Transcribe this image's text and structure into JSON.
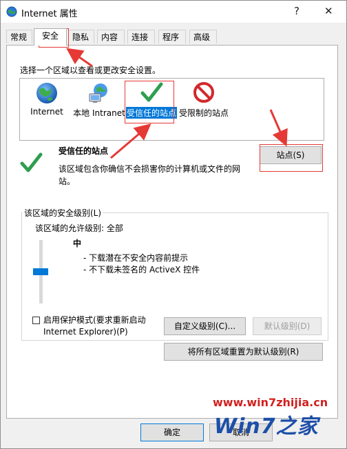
{
  "window": {
    "title": "Internet 属性",
    "help": "?",
    "close": "✕"
  },
  "tabs": [
    {
      "label": "常规"
    },
    {
      "label": "安全"
    },
    {
      "label": "隐私"
    },
    {
      "label": "内容"
    },
    {
      "label": "连接"
    },
    {
      "label": "程序"
    },
    {
      "label": "高级"
    }
  ],
  "security": {
    "instruction": "选择一个区域以查看或更改安全设置。",
    "zones": [
      {
        "label": "Internet",
        "icon": "globe-icon"
      },
      {
        "label": "本地 Intranet",
        "icon": "intranet-icon"
      },
      {
        "label": "受信任的站点",
        "icon": "checkmark-icon"
      },
      {
        "label": "受限制的站点",
        "icon": "restricted-icon"
      }
    ],
    "selected_zone": {
      "title": "受信任的站点",
      "description": "该区域包含你确信不会损害你的计算机或文件的网站。",
      "sites_button": "站点(S)"
    },
    "level_group": {
      "legend": "该区域的安全级别(L)",
      "allowed": "该区域的允许级别: 全部",
      "level_name": "中",
      "level_value": 0.5,
      "bullets": [
        "- 下载潜在不安全内容前提示",
        "- 不下载未签名的 ActiveX 控件"
      ],
      "protected_mode_label": "启用保护模式(要求重新启动 Internet Explorer)(P)",
      "custom_button": "自定义级别(C)...",
      "default_button": "默认级别(D)"
    },
    "reset_all_button": "将所有区域重置为默认级别(R)"
  },
  "footer": {
    "ok": "确定",
    "cancel": "取消"
  },
  "watermark": {
    "url": "www.win7zhijia.cn",
    "logo": "Win7之家"
  },
  "colors": {
    "accent": "#0078d7",
    "annotation": "#e53935",
    "check": "#2e9e4f"
  }
}
